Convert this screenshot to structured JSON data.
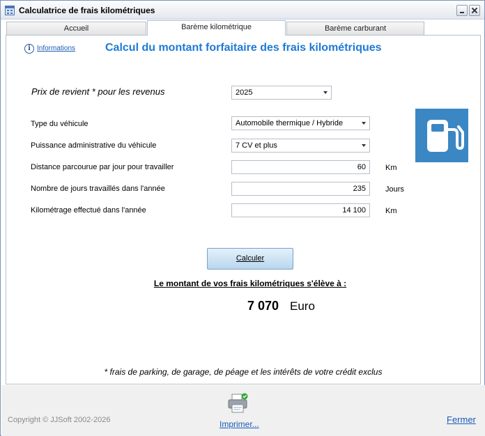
{
  "window": {
    "title": "Calculatrice de frais kilométriques"
  },
  "tabs": [
    {
      "label": "Accueil",
      "active": false
    },
    {
      "label": "Barème kilométrique",
      "active": true
    },
    {
      "label": "Barème carburant",
      "active": false
    }
  ],
  "header": {
    "info_link": "Informations",
    "title": "Calcul du montant forfaitaire des frais kilométriques"
  },
  "form": {
    "prix_label": "Prix de revient * pour les revenus",
    "prix_value": "2025",
    "type_label": "Type du véhicule",
    "type_value": "Automobile thermique / Hybride",
    "puissance_label": "Puissance administrative du véhicule",
    "puissance_value": "7 CV et plus",
    "distance_label": "Distance parcourue par jour pour travailler",
    "distance_value": "60",
    "distance_unit": "Km",
    "jours_label": "Nombre de jours travaillés dans l'année",
    "jours_value": "235",
    "jours_unit": "Jours",
    "km_label": "Kilométrage effectué dans l'année",
    "km_value": "14 100",
    "km_unit": "Km"
  },
  "actions": {
    "calc_label": "Calculer"
  },
  "result": {
    "label": "Le montant de vos frais kilométriques s'élève à :",
    "amount": "7 070",
    "unit": "Euro"
  },
  "footnote": "* frais de parking, de garage, de péage et les intérêts de votre crédit exclus",
  "footer": {
    "copyright": "Copyright © JJSoft 2002-2026",
    "print_label": "Imprimer...",
    "close_label": "Fermer"
  },
  "colors": {
    "accent": "#1d7ad6",
    "tile": "#3b87c4",
    "link": "#1a5bb8"
  },
  "icons": [
    "calculator-icon",
    "info-icon",
    "fuel-pump-icon",
    "printer-icon"
  ]
}
